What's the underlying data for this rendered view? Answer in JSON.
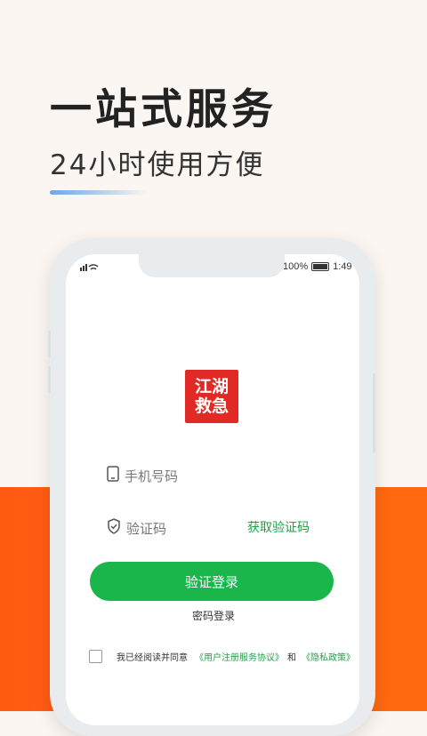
{
  "hero": {
    "headline": "一站式服务",
    "subline": "24小时使用方便"
  },
  "status_bar": {
    "signal": "“•ıl",
    "battery_pct": "100%",
    "time": "1:49"
  },
  "logo": {
    "line1": "江湖",
    "line2": "救急"
  },
  "form": {
    "phone_placeholder": "手机号码",
    "code_placeholder": "验证码",
    "get_code_label": "获取验证码",
    "login_button": "验证登录",
    "password_login_link": "密码登录"
  },
  "agreement": {
    "prefix": "我已经阅读并同意",
    "user_agreement": "《用户注册服务协议》",
    "connector": "和",
    "privacy_policy": "《隐私政策》"
  },
  "colors": {
    "accent_green": "#1ab64c",
    "link_green": "#21a048",
    "brand_red": "#e12a25",
    "orange_bg": "#ff5a12"
  }
}
